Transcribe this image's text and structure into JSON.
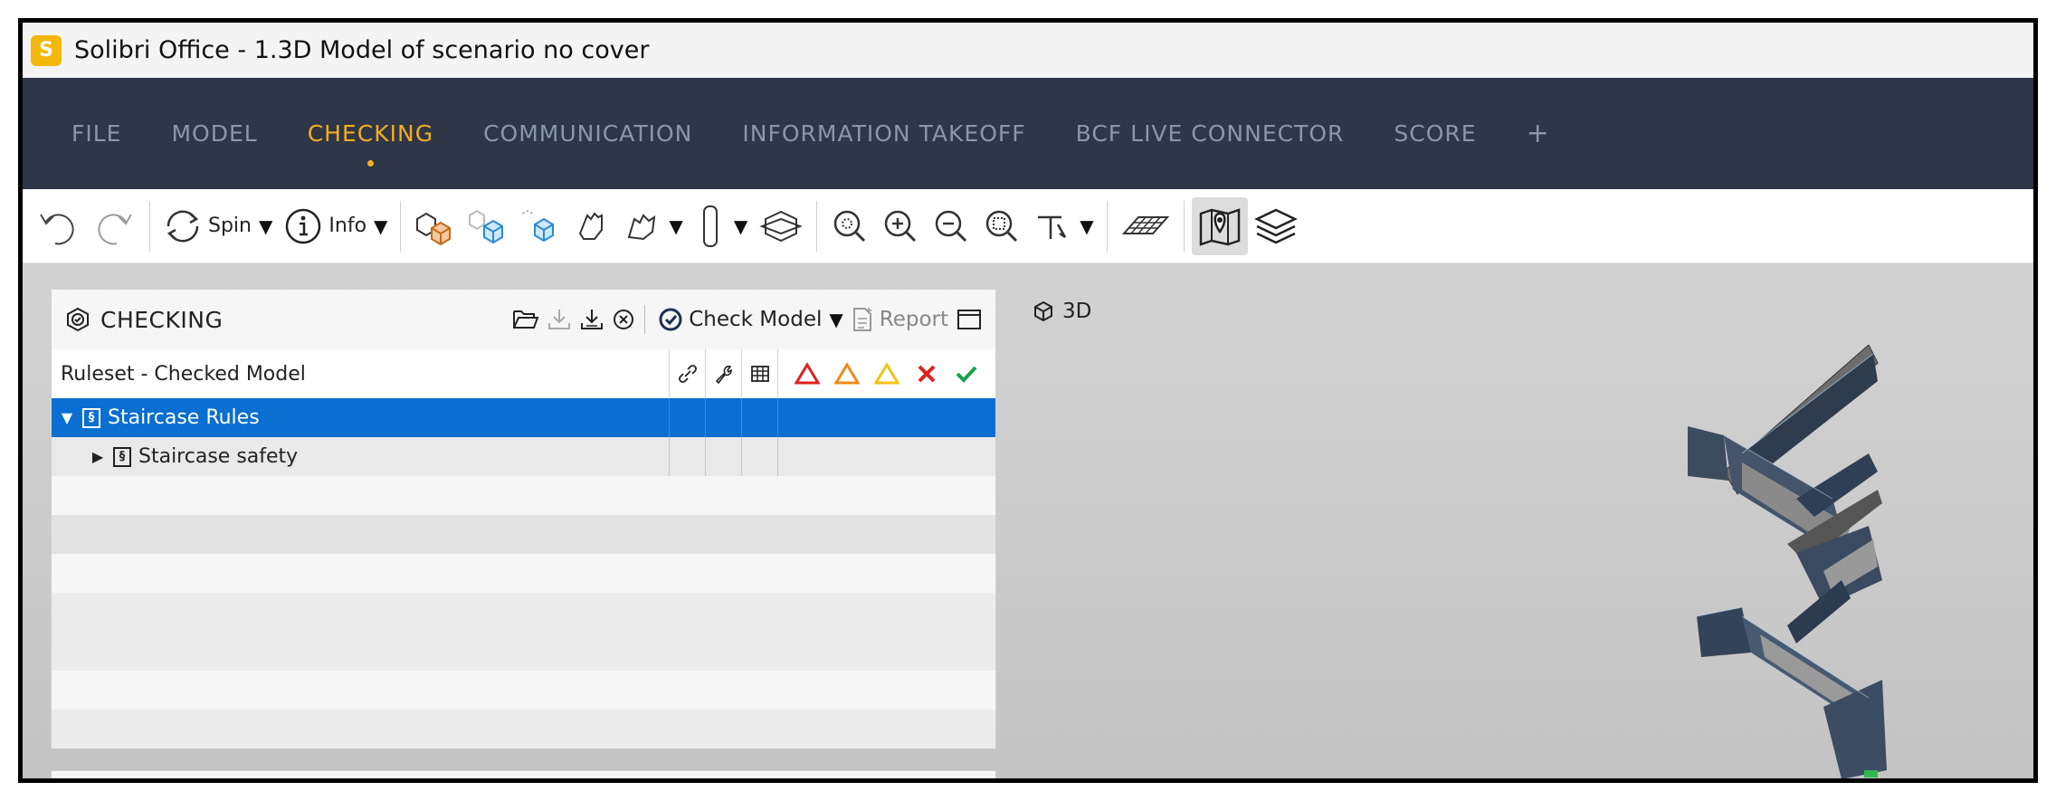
{
  "window": {
    "title": "Solibri Office - 1.3D Model of scenario no cover",
    "logo_letter": "S"
  },
  "nav": {
    "items": [
      "FILE",
      "MODEL",
      "CHECKING",
      "COMMUNICATION",
      "INFORMATION TAKEOFF",
      "BCF LIVE CONNECTOR",
      "SCORE"
    ],
    "active": "CHECKING",
    "plus": "+"
  },
  "toolbar": {
    "spin_label": "Spin",
    "info_label": "Info"
  },
  "checking_panel": {
    "title": "CHECKING",
    "check_model_label": "Check Model",
    "report_label": "Report",
    "column_header": "Ruleset - Checked Model",
    "rows": [
      {
        "label": "Staircase Rules",
        "expanded": true,
        "selected": true
      },
      {
        "label": "Staircase  safety",
        "expanded": false,
        "selected": false
      }
    ],
    "severity_colors": {
      "critical": "#e02020",
      "moderate": "#f08a1a",
      "low": "#f2c21b",
      "rejected": "#e02020",
      "accepted": "#1aa34a"
    }
  },
  "view": {
    "label": "3D"
  },
  "colors": {
    "nav_bg": "#2e3648",
    "nav_active": "#f4ad1e",
    "selection": "#0a6fd0"
  }
}
